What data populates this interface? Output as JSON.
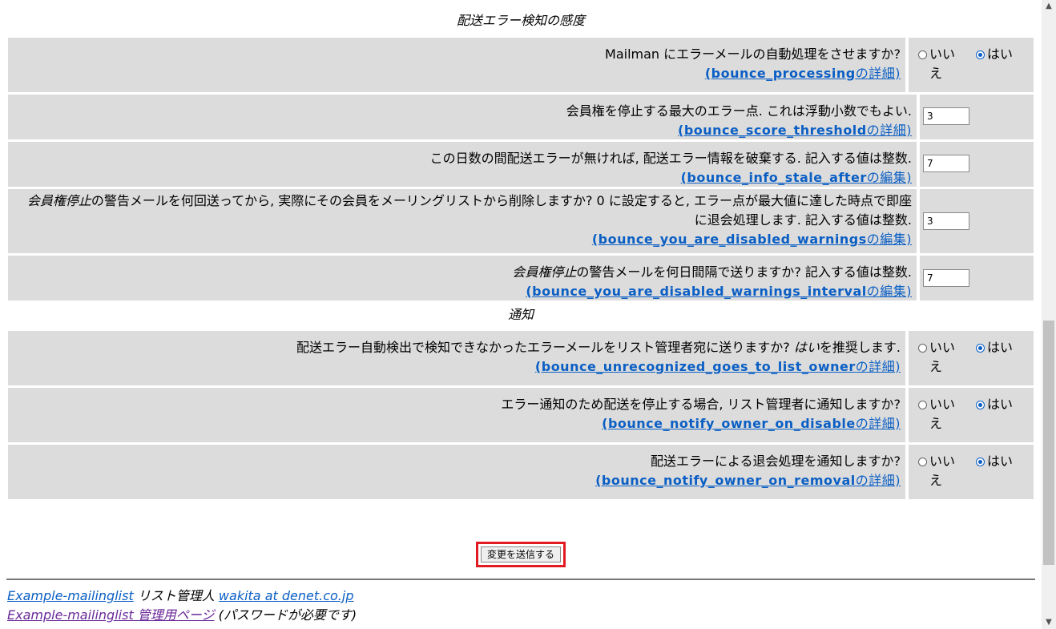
{
  "sections": {
    "sensitivity_title": "配送エラー検知の感度",
    "notify_title": "通知"
  },
  "rows": [
    {
      "question": "Mailman にエラーメールの自動処理をさせますか?",
      "link_var": "(bounce_processing",
      "link_tail": "の詳細)",
      "control": "radio",
      "options": [
        "いいえ",
        "はい"
      ],
      "selected": "はい"
    },
    {
      "question": "会員権を停止する最大のエラー点. これは浮動小数でもよい.",
      "link_var": "(bounce_score_threshold",
      "link_tail": "の詳細)",
      "control": "text",
      "value": "3"
    },
    {
      "question": "この日数の間配送エラーが無ければ, 配送エラー情報を破棄する. 記入する値は整数.",
      "link_var": "(bounce_info_stale_after",
      "link_tail": "の編集)",
      "control": "text",
      "value": "7"
    },
    {
      "question_em": "会員権停止",
      "question": "の警告メールを何回送ってから, 実際にその会員をメーリングリストから削除しますか? 0 に設定すると, エラー点が最大値に達した時点で即座に退会処理します. 記入する値は整数.",
      "link_var": "(bounce_you_are_disabled_warnings",
      "link_tail": "の編集)",
      "control": "text",
      "value": "3"
    },
    {
      "question_em": "会員権停止",
      "question": "の警告メールを何日間隔で送りますか? 記入する値は整数.",
      "link_var": "(bounce_you_are_disabled_warnings_interval",
      "link_tail": "の編集)",
      "control": "text",
      "value": "7"
    },
    {
      "question": "配送エラー自動検出で検知できなかったエラーメールをリスト管理者宛に送りますか?",
      "question_em_after": "はい",
      "question_after": "を推奨します.",
      "link_var": "(bounce_unrecognized_goes_to_list_owner",
      "link_tail": "の詳細)",
      "control": "radio",
      "options": [
        "いいえ",
        "はい"
      ],
      "selected": "はい"
    },
    {
      "question": "エラー通知のため配送を停止する場合, リスト管理者に通知しますか?",
      "link_var": "(bounce_notify_owner_on_disable",
      "link_tail": "の詳細)",
      "control": "radio",
      "options": [
        "いいえ",
        "はい"
      ],
      "selected": "はい"
    },
    {
      "question": "配送エラーによる退会処理を通知しますか?",
      "link_var": "(bounce_notify_owner_on_removal",
      "link_tail": "の詳細)",
      "control": "radio",
      "options": [
        "いいえ",
        "はい"
      ],
      "selected": "はい"
    }
  ],
  "submit_label": "変更を送信する",
  "footer": {
    "list_link": "Example-mailinglist",
    "admin_text": "リスト管理人",
    "admin_email": "wakita at denet.co.jp",
    "admin_page_link": "Example-mailinglist 管理用ページ",
    "password_note": "(パスワードが必要です)"
  },
  "colors": {
    "row_bg": "#dcdcdc",
    "link": "#0b5fc4",
    "visited_link": "#6a2a9a",
    "highlight_border": "#e21b23"
  }
}
